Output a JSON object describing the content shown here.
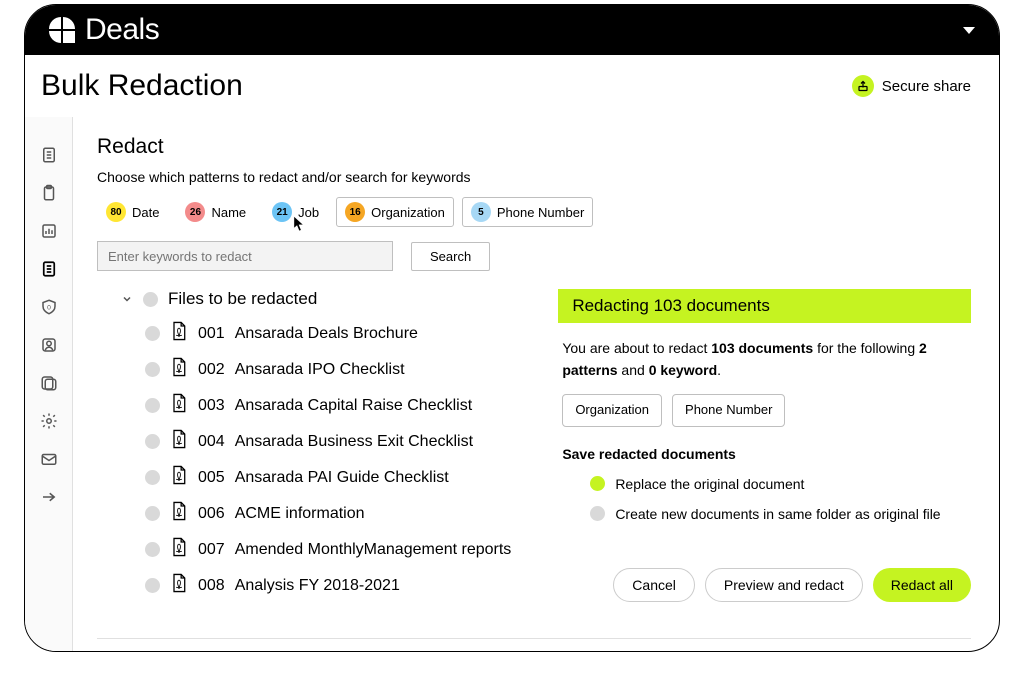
{
  "brand": "Deals",
  "page_title": "Bulk Redaction",
  "secure_share": "Secure share",
  "redact": {
    "title": "Redact",
    "subtitle": "Choose which patterns to redact and/or search for keywords",
    "patterns": [
      {
        "count": "80",
        "label": "Date",
        "color": "#ffe633",
        "boxed": false
      },
      {
        "count": "26",
        "label": "Name",
        "color": "#f38b8b",
        "boxed": false
      },
      {
        "count": "21",
        "label": "Job",
        "color": "#6cc4f5",
        "boxed": false
      },
      {
        "count": "16",
        "label": "Organization",
        "color": "#f5a623",
        "boxed": true
      },
      {
        "count": "5",
        "label": "Phone Number",
        "color": "#a7d8f5",
        "boxed": true
      }
    ],
    "search_placeholder": "Enter keywords to redact",
    "search_button": "Search"
  },
  "files": {
    "header": "Files to be redacted",
    "items": [
      {
        "num": "001",
        "name": "Ansarada Deals Brochure"
      },
      {
        "num": "002",
        "name": "Ansarada IPO Checklist"
      },
      {
        "num": "003",
        "name": "Ansarada Capital Raise Checklist"
      },
      {
        "num": "004",
        "name": "Ansarada Business Exit Checklist"
      },
      {
        "num": "005",
        "name": "Ansarada PAI Guide Checklist"
      },
      {
        "num": "006",
        "name": "ACME information"
      },
      {
        "num": "007",
        "name": "Amended MonthlyManagement reports"
      },
      {
        "num": "008",
        "name": "Analysis FY 2018-2021"
      }
    ]
  },
  "summary": {
    "banner": "Redacting 103 documents",
    "text_pre": "You are about to redact ",
    "doc_count": "103 documents",
    "text_mid1": " for the following ",
    "pattern_count": "2 patterns",
    "text_mid2": " and ",
    "keyword_count": "0 keyword",
    "text_end": ".",
    "tags": [
      "Organization",
      "Phone Number"
    ],
    "save_title": "Save redacted documents",
    "options": [
      {
        "label": "Replace the original document",
        "selected": true
      },
      {
        "label": "Create new documents in same folder as original file",
        "selected": false
      }
    ]
  },
  "actions": {
    "cancel": "Cancel",
    "preview": "Preview and redact",
    "redact_all": "Redact all"
  },
  "sidebar_icons": [
    "document-icon",
    "clipboard-icon",
    "chart-icon",
    "page-icon",
    "shield-icon",
    "user-icon",
    "users-icon",
    "gear-icon",
    "mail-icon",
    "arrow-right-icon"
  ]
}
